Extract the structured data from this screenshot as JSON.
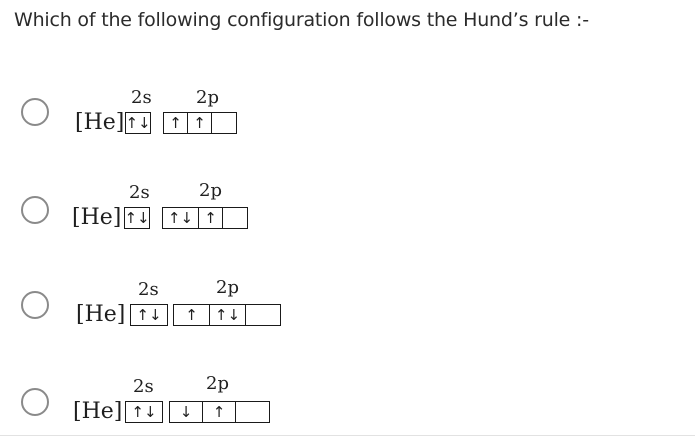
{
  "question": {
    "text": "Which of the following configuration follows the Hund’s rule :-"
  },
  "options": [
    {
      "core": "[He]",
      "s_label": "2s",
      "p_label": "2p",
      "s_cells": [
        "↑↓"
      ],
      "p_cells": [
        "↑",
        "↑",
        ""
      ]
    },
    {
      "core": "[He]",
      "s_label": "2s",
      "p_label": "2p",
      "s_cells": [
        "↑↓"
      ],
      "p_cells": [
        "↑↓",
        "↑",
        ""
      ]
    },
    {
      "core": "[He]",
      "s_label": "2s",
      "p_label": "2p",
      "s_cells": [
        "↑↓"
      ],
      "p_cells": [
        "↑",
        "↑↓",
        ""
      ]
    },
    {
      "core": "[He]",
      "s_label": "2s",
      "p_label": "2p",
      "s_cells": [
        "↑↓"
      ],
      "p_cells": [
        "↓",
        "↑",
        ""
      ]
    }
  ],
  "colors": {
    "radio_border": "#8a8a8a",
    "text": "#1f1f1f"
  }
}
